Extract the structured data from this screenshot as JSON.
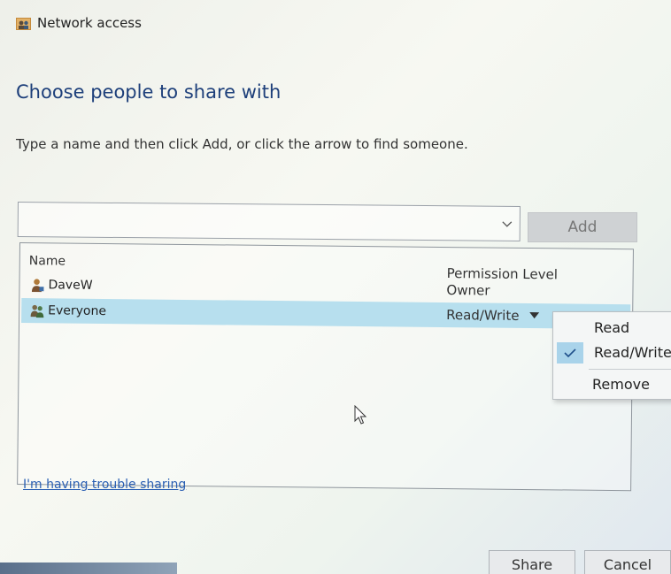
{
  "window": {
    "title": "Network access"
  },
  "heading": "Choose people to share with",
  "instructions": "Type a name and then click Add, or click the arrow to find someone.",
  "name_input": {
    "value": "",
    "placeholder": ""
  },
  "add_button": "Add",
  "list": {
    "columns": {
      "name": "Name",
      "permission": "Permission Level"
    },
    "rows": [
      {
        "name": "DaveW",
        "permission": "Owner"
      },
      {
        "name": "Everyone",
        "permission": "Read/Write"
      }
    ]
  },
  "permission_menu": {
    "items": [
      "Read",
      "Read/Write",
      "Remove"
    ],
    "checked": "Read/Write"
  },
  "trouble_link": "I'm having trouble sharing",
  "buttons": {
    "share": "Share",
    "cancel": "Cancel"
  },
  "colors": {
    "heading": "#1d3f7a",
    "selection": "#b7dfee",
    "link": "#2a5fb3",
    "check_highlight": "#a9d3ea"
  },
  "icons": {
    "app": "network-people-icon",
    "user": "user-icon",
    "group": "group-users-icon",
    "dropdown": "chevron-down-icon",
    "check": "checkmark-icon",
    "cursor": "mouse-pointer-icon"
  }
}
